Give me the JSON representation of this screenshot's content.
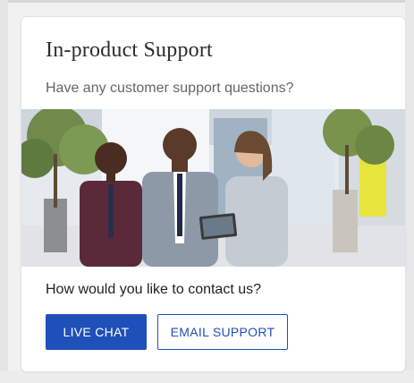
{
  "card": {
    "title": "In-product Support",
    "subtitle": "Have any customer support questions?",
    "photo_alt": "Three colleagues looking at a tablet in an office lobby",
    "question": "How would you like to contact us?"
  },
  "actions": {
    "live_chat_label": "LIVE CHAT",
    "email_support_label": "EMAIL SUPPORT"
  },
  "colors": {
    "primary": "#1f4fb8",
    "title_text": "#2c2c2c",
    "subtitle_text": "#666666"
  }
}
